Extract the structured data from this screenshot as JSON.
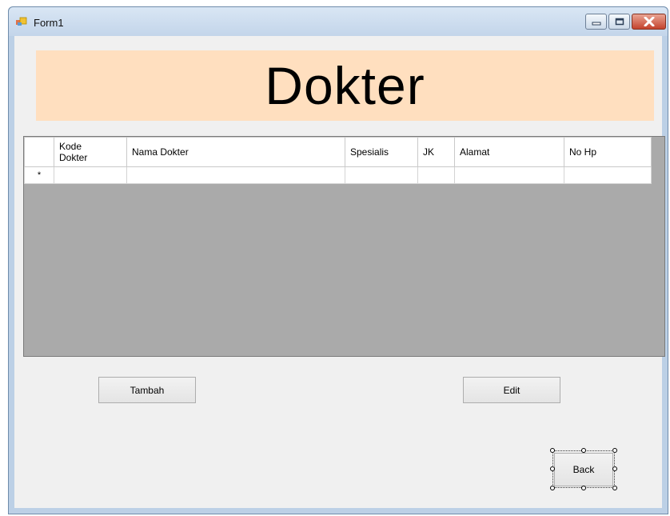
{
  "window": {
    "title": "Form1",
    "icon": "winforms-app-icon",
    "controls": [
      "minimize-icon",
      "maximize-icon",
      "close-icon"
    ]
  },
  "header": {
    "title": "Dokter",
    "background_color": "#ffdfbf"
  },
  "grid": {
    "columns": [
      "Kode\nDokter",
      "Nama Dokter",
      "Spesialis",
      "JK",
      "Alamat",
      "No Hp"
    ],
    "new_row_marker": "*",
    "rows": [],
    "background_color": "#aaaaaa"
  },
  "buttons": {
    "tambah": "Tambah",
    "edit": "Edit",
    "back": "Back"
  }
}
